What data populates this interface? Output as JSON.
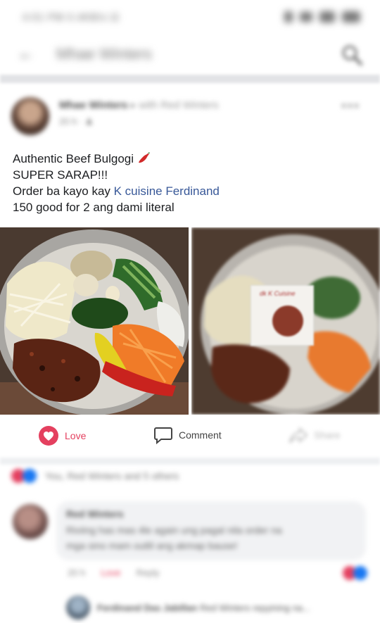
{
  "status_bar": {
    "time_text": "4:01 PM 0.4KB/s ⊡",
    "right_text": "⊡ ᯤ .ıl .ıl 50"
  },
  "header": {
    "title": "Mhae Winters",
    "back_icon": "arrow-left-icon",
    "search_icon": "search-icon"
  },
  "post": {
    "author": "Mhae Winters",
    "author_extra": "▸ with Red Winters",
    "meta": "20 h · ",
    "privacy_icon": "friends-icon",
    "text_lines": [
      "Authentic Beef Bulgogi",
      "SUPER SARAP!!!",
      "Order ba kayo kay ",
      "150 good for 2 ang dami literal"
    ],
    "mention": "K cuisine Ferdinand",
    "pepper_icon": "chili-pepper-icon",
    "photo_label": "dk K Cuisine"
  },
  "actions": {
    "love_label": "Love",
    "comment_label": "Comment",
    "share_label": "Share"
  },
  "reactions": {
    "summary": "You, Red Winters and 5 others"
  },
  "comment": {
    "author": "Red Winters",
    "body_line1": "Riviing has mas 4le again ung pagal nila order na",
    "body_line2": "mga sino mam outlil ang akmap bause!",
    "time": "20 h",
    "like_label": "Love",
    "reply_label": "Reply",
    "reply_preview_author": "Ferdinand Das Jabillan",
    "reply_preview_text": "Red Winters repyining na..."
  },
  "colors": {
    "love": "#e4405f",
    "link": "#385898",
    "like_blue": "#1877f2"
  }
}
